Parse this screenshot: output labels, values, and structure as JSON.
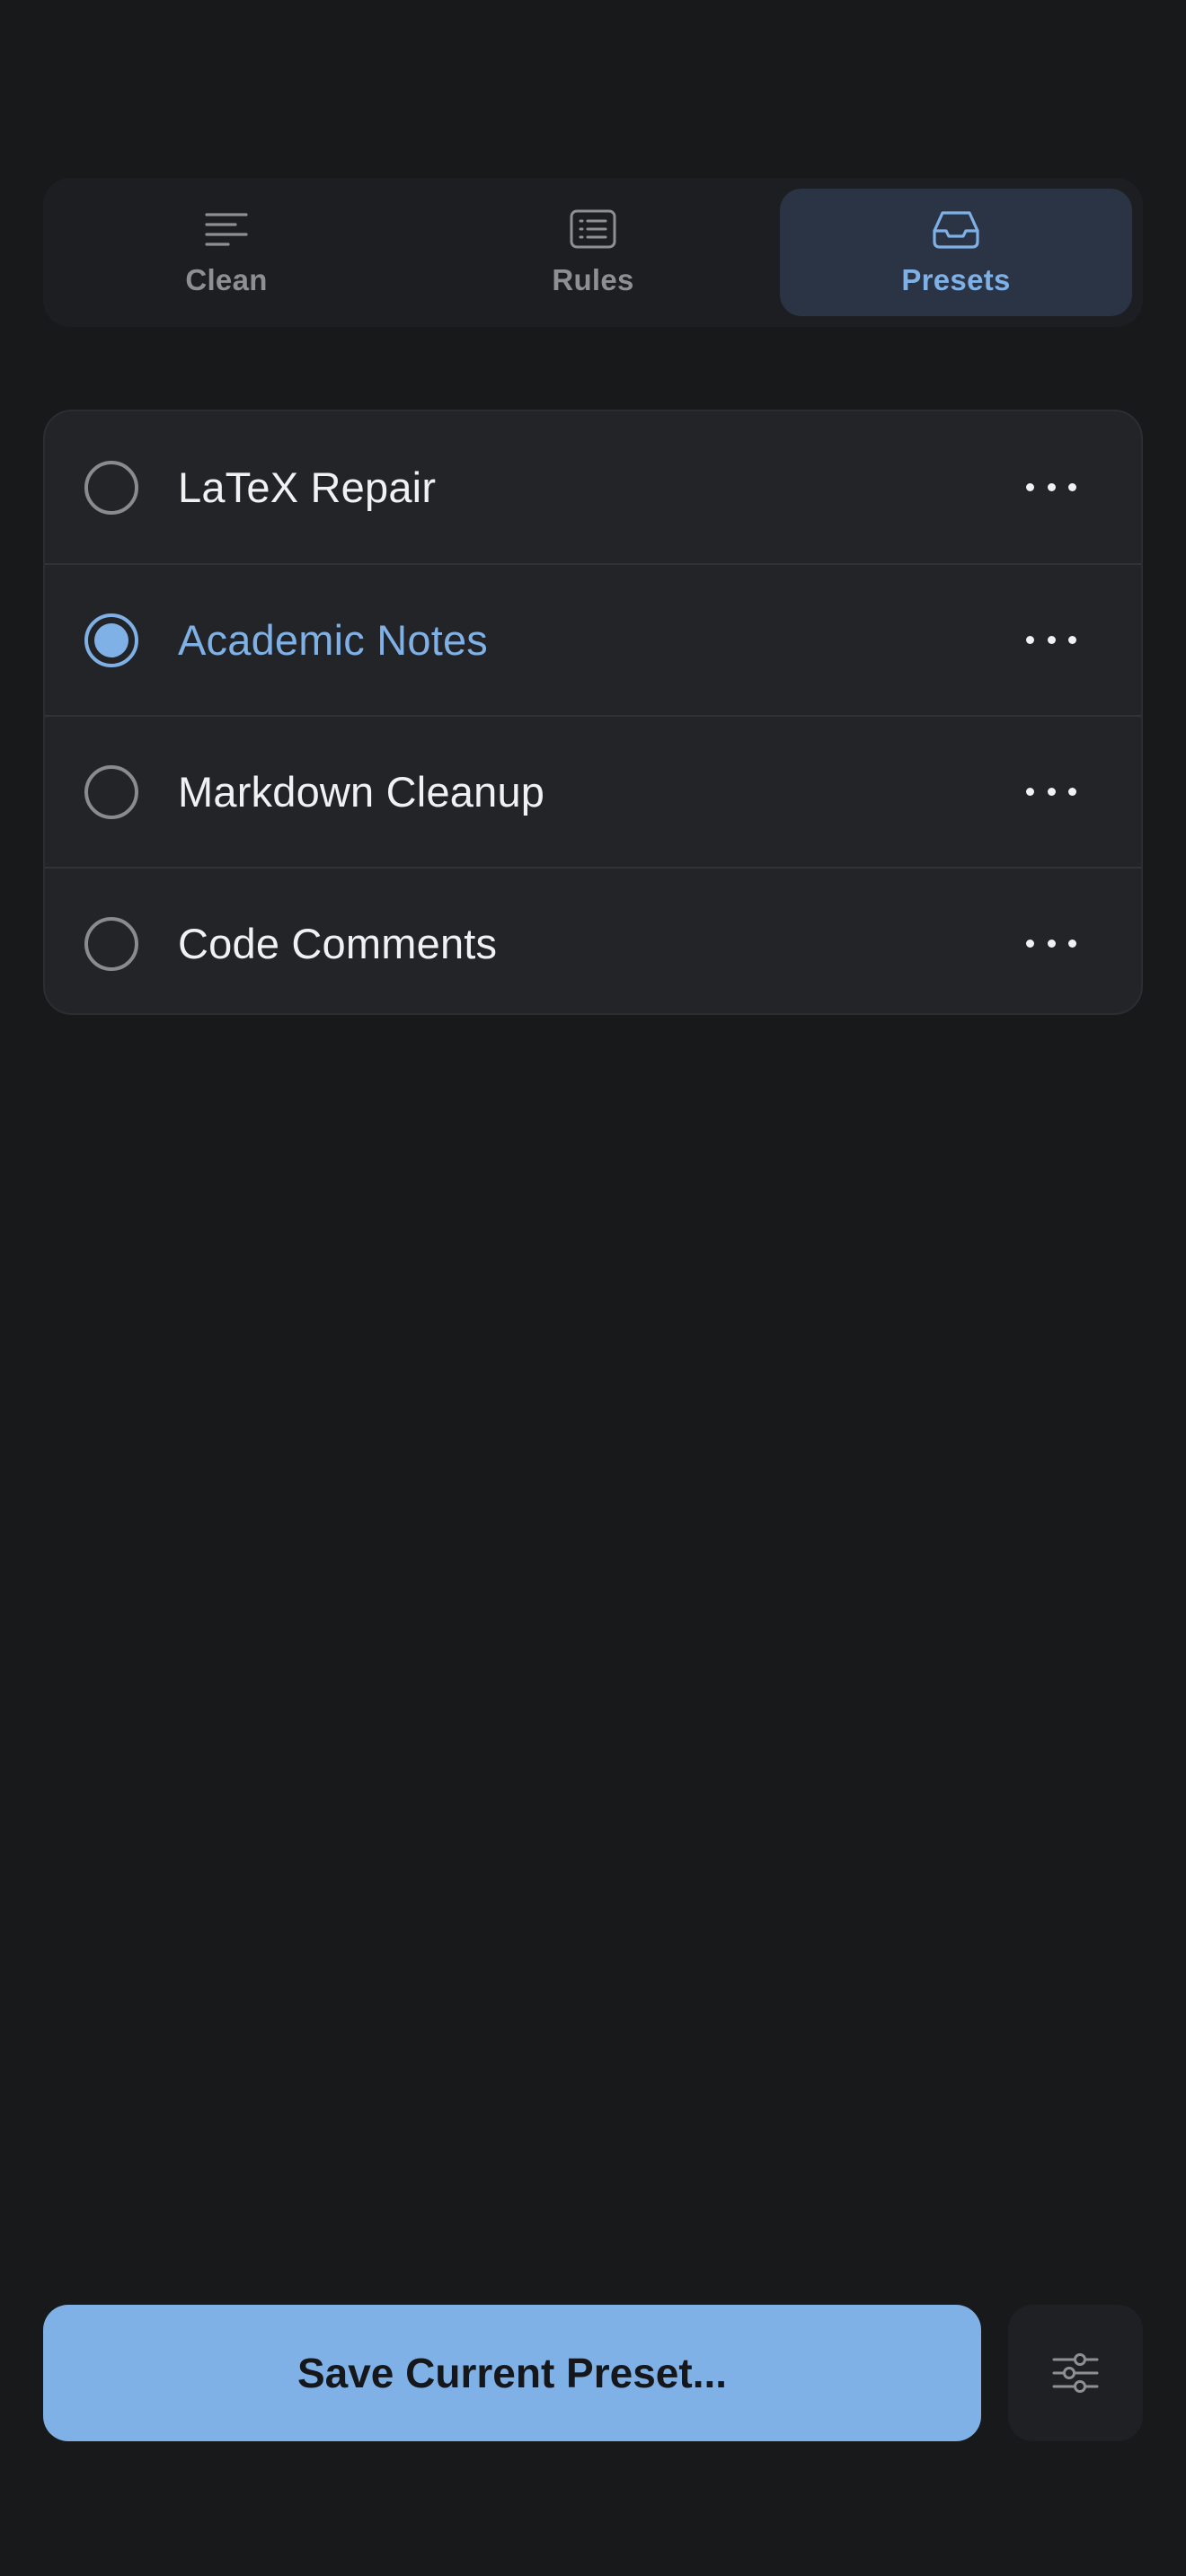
{
  "tabs": {
    "clean": {
      "label": "Clean",
      "icon": "text-align-left-icon"
    },
    "rules": {
      "label": "Rules",
      "icon": "list-rules-icon"
    },
    "presets": {
      "label": "Presets",
      "icon": "tray-inbox-icon",
      "active": true
    }
  },
  "presets": [
    {
      "name": "LaTeX Repair",
      "selected": false
    },
    {
      "name": "Academic Notes",
      "selected": true
    },
    {
      "name": "Markdown Cleanup",
      "selected": false
    },
    {
      "name": "Code Comments",
      "selected": false
    }
  ],
  "footer": {
    "save_label": "Save Current Preset...",
    "settings_icon": "sliders-icon"
  },
  "colors": {
    "background": "#18191b",
    "accent": "#7fb0e6",
    "card": "#232427",
    "active_tab": "#2a3445"
  }
}
